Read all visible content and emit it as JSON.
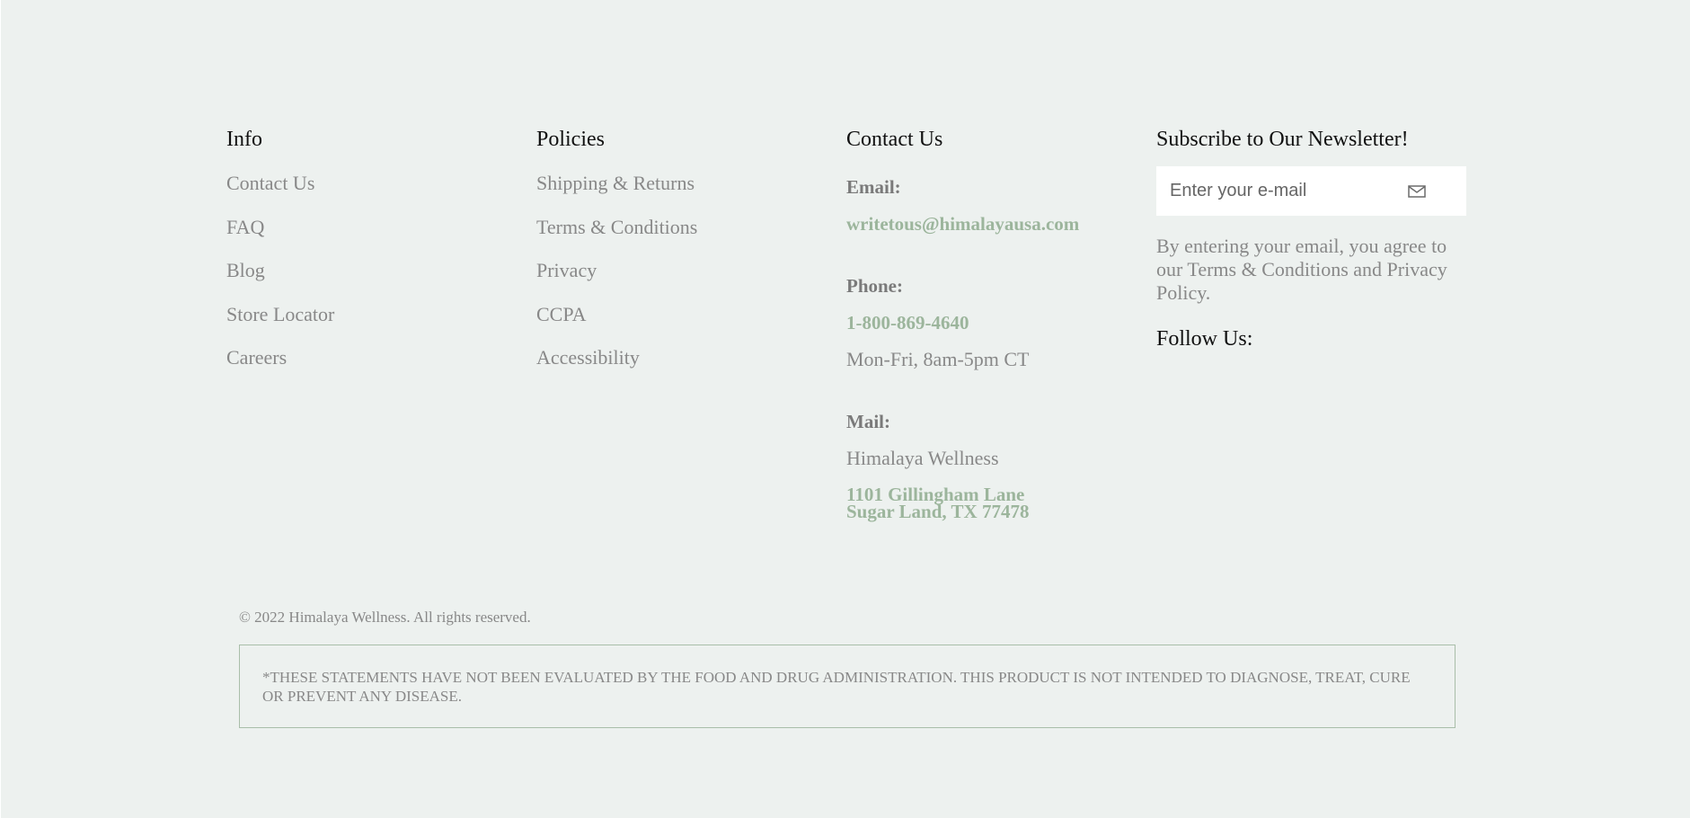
{
  "info": {
    "title": "Info",
    "links": [
      "Contact Us",
      "FAQ",
      "Blog",
      "Store Locator",
      "Careers"
    ]
  },
  "policies": {
    "title": "Policies",
    "links": [
      "Shipping & Returns",
      "Terms & Conditions",
      "Privacy",
      "CCPA",
      "Accessibility"
    ]
  },
  "contact": {
    "title": "Contact Us",
    "email_label": "Email:",
    "email": "writetous@himalayausa.com",
    "phone_label": "Phone:",
    "phone": "1-800-869-4640",
    "hours": "Mon-Fri, 8am-5pm CT",
    "mail_label": "Mail:",
    "company": "Himalaya Wellness",
    "address_line1": "1101 Gillingham Lane",
    "address_line2": "Sugar Land, TX 77478"
  },
  "newsletter": {
    "title": "Subscribe to Our Newsletter!",
    "placeholder": "Enter your e-mail",
    "submit_icon": "mail-icon",
    "agreement": "By entering your email, you agree to our Terms & Conditions and Privacy Policy.",
    "follow": "Follow Us:"
  },
  "footer": {
    "copyright": "© 2022 Himalaya Wellness. All rights reserved.",
    "disclaimer": "*THESE STATEMENTS HAVE NOT BEEN EVALUATED BY THE FOOD AND DRUG ADMINISTRATION. THIS PRODUCT IS NOT INTENDED TO DIAGNOSE, TREAT, CURE OR PREVENT ANY DISEASE."
  },
  "colors": {
    "background": "#edf1ef",
    "accent_green": "#9cb59c",
    "muted_text": "#888888",
    "heading_text": "#111111"
  }
}
